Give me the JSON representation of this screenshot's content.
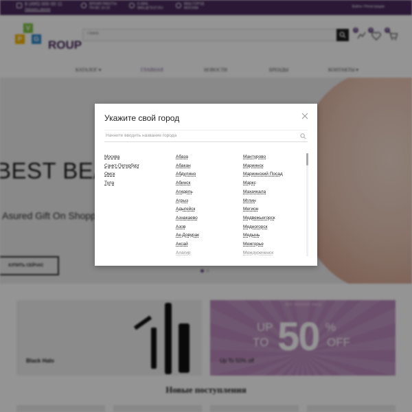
{
  "topbar": {
    "phone": "8 (495) 000 00 11",
    "callback": "Заказать звонок",
    "hours_label": "ВРЕМЯ РАБОТЫ",
    "hours_value": "ПН-ВС 10-19",
    "email_label": "E-MAIL",
    "email_value": "MAIL@TEST.RU",
    "city_label": "ВАШ ГОРОД",
    "city_value": "МОСКВА",
    "login": "Войти / Регистрация"
  },
  "header": {
    "logo_letters": [
      "V",
      "P",
      "G"
    ],
    "logo_text": "ROUP",
    "search_placeholder": "Поиск",
    "badges": {
      "compare": "0",
      "favorites": "0",
      "cart": "0"
    }
  },
  "nav": {
    "items": [
      {
        "label": "КАТАЛОГ",
        "has_dropdown": true
      },
      {
        "label": "ГЛАВНАЯ",
        "active": true
      },
      {
        "label": "НОВОСТИ"
      },
      {
        "label": "БРЕНДЫ"
      },
      {
        "label": "КОНТАКТЫ",
        "has_dropdown": true
      }
    ],
    "chevron": "▾"
  },
  "hero": {
    "title": "BEST BEAU",
    "subtitle": "t Asured Gift On Shopp",
    "button": "КУПИТЬ СЕЙЧАС"
  },
  "banners": {
    "left_label": "Black Halo",
    "right_tag": "BIG SEASON SALE",
    "right_up": "UP",
    "right_to": "TO",
    "right_number": "50",
    "right_pct": "%",
    "right_off": "OFF",
    "right_label": "Up To 50% off"
  },
  "section_title": "Новые поступления",
  "modal": {
    "title": "Укажите свой город",
    "search_placeholder": "Начните вводить название города",
    "main_cities": [
      "Москва",
      "Санкт-Петербург",
      "Омск",
      "Тула"
    ],
    "column2": [
      "Абаза",
      "Абакан",
      "Абдулино",
      "Абинск",
      "Агидель",
      "Агрыз",
      "Адыгейск",
      "Азнакаево",
      "Азов",
      "Ак-Довурак",
      "Аксай",
      "Алагир"
    ],
    "column3": [
      "Мантурово",
      "Мариинск",
      "Мариинский Посад",
      "Маркс",
      "Махачкала",
      "Мглин",
      "Мегион",
      "Медвежьегорск",
      "Медногорск",
      "Медынь",
      "Межгорье",
      "Междуреченск"
    ]
  },
  "colors": {
    "brand": "#4a2a5e",
    "accent": "#6d4c85",
    "logo_v": "#7cc243",
    "logo_p": "#f4b400",
    "logo_g": "#2f88c8",
    "sale_bg": "#b989bb",
    "overlay": "rgba(0,0,0,0.42)"
  },
  "icons": {
    "close": "close-icon",
    "search": "search-icon",
    "compare": "compare-icon",
    "favorites": "heart-icon",
    "cart": "cart-icon"
  }
}
